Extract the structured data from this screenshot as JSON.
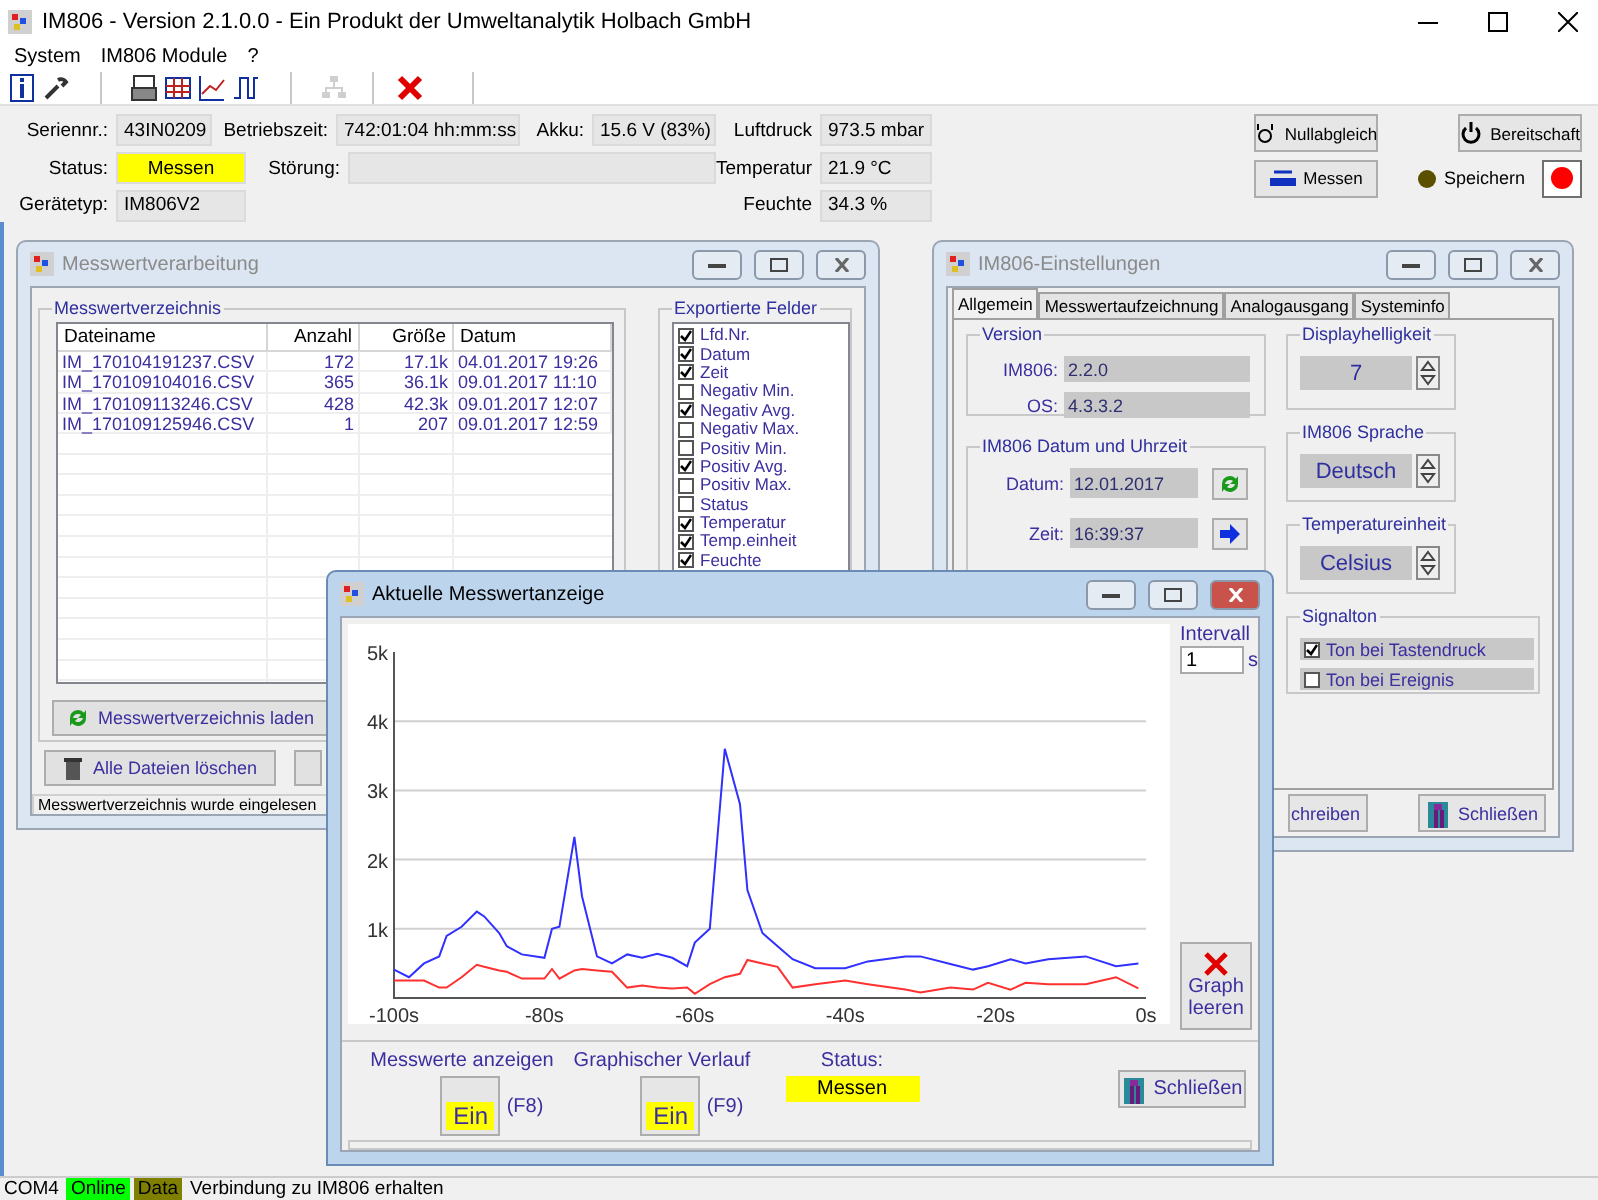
{
  "window": {
    "title": "IM806 - Version 2.1.0.0 - Ein Produkt der Umweltanalytik Holbach GmbH"
  },
  "menu": [
    "System",
    "IM806 Module",
    "?"
  ],
  "toolbar": [
    {
      "disabled": false
    },
    {
      "disabled": false
    },
    {
      "disabled": false
    },
    {
      "disabled": false
    },
    {
      "disabled": false
    },
    {
      "disabled": false
    },
    {
      "disabled": true
    },
    {
      "disabled": false
    }
  ],
  "info_rows": [
    [
      {
        "label": "Seriennr.:",
        "value": "43IN0209",
        "highlighted": false
      },
      {
        "label": "Betriebszeit:",
        "value": "742:01:04 hh:mm:ss",
        "highlighted": false
      },
      {
        "label": "Akku:",
        "value": "15.6 V (83%)",
        "highlighted": false
      },
      {
        "label": "Luftdruck",
        "value": "973.5 mbar",
        "highlighted": false
      }
    ],
    [
      {
        "label": "Status:",
        "value": "Messen",
        "highlighted": true
      },
      {
        "label": "Störung:",
        "highlighted": false
      },
      {
        "label": "Temperatur",
        "value": "21.9 °C",
        "highlighted": false
      }
    ],
    [
      {
        "label": "Gerätetyp:",
        "value": "IM806V2",
        "highlighted": false
      },
      {
        "label": "Feuchte",
        "value": "34.3 %",
        "highlighted": false
      }
    ]
  ],
  "actions": {
    "zero": "Nullabgleich",
    "standby": "Bereitschaft",
    "measure": "Messen",
    "save": {
      "label": "Speichern",
      "on": false
    }
  },
  "processing_window": {
    "title": "Messwertverarbeitung",
    "active": false,
    "directory": {
      "title": "Messwertverzeichnis",
      "columns": [
        "Dateiname",
        "Anzahl",
        "Größe",
        "Datum"
      ],
      "rows": [
        [
          "IM_170104191237.CSV",
          "172",
          "17.1k",
          "04.01.2017 19:26"
        ],
        [
          "IM_170109104016.CSV",
          "365",
          "36.1k",
          "09.01.2017 11:10"
        ],
        [
          "IM_170109113246.CSV",
          "428",
          "42.3k",
          "09.01.2017 12:07"
        ],
        [
          "IM_170109125946.CSV",
          "1",
          "207",
          "09.01.2017 12:59"
        ]
      ],
      "load_button": "Messwertverzeichnis laden"
    },
    "export": {
      "title": "Exportierte Felder",
      "fields": [
        {
          "label": "Lfd.Nr.",
          "checked": true
        },
        {
          "label": "Datum",
          "checked": true
        },
        {
          "label": "Zeit",
          "checked": true
        },
        {
          "label": "Negativ Min.",
          "checked": false
        },
        {
          "label": "Negativ Avg.",
          "checked": true
        },
        {
          "label": "Negativ Max.",
          "checked": false
        },
        {
          "label": "Positiv Min.",
          "checked": false
        },
        {
          "label": "Positiv Avg.",
          "checked": true
        },
        {
          "label": "Positiv Max.",
          "checked": false
        },
        {
          "label": "Status",
          "checked": false
        },
        {
          "label": "Temperatur",
          "checked": true
        },
        {
          "label": "Temp.einheit",
          "checked": true
        },
        {
          "label": "Feuchte",
          "checked": true
        }
      ]
    },
    "delete_button": "Alle Dateien löschen",
    "status": "Messwertverzeichnis wurde eingelesen"
  },
  "settings_window": {
    "title": "IM806-Einstellungen",
    "active": false,
    "tabs": [
      {
        "label": "Allgemein",
        "selected": true
      },
      {
        "label": "Messwertaufzeichnung",
        "selected": false
      },
      {
        "label": "Analogausgang",
        "selected": false
      },
      {
        "label": "Systeminfo",
        "selected": false
      }
    ],
    "version": {
      "title": "Version",
      "fields": [
        {
          "label": "IM806:",
          "value": "2.2.0"
        },
        {
          "label": "OS:",
          "value": "4.3.3.2"
        }
      ]
    },
    "datetime": {
      "title": "IM806 Datum und Uhrzeit",
      "date_label": "Datum:",
      "date": "12.01.2017",
      "time_label": "Zeit:",
      "time": "16:39:37"
    },
    "brightness": {
      "title": "Displayhelligkeit",
      "value": "7"
    },
    "language": {
      "title": "IM806 Sprache",
      "value": "Deutsch"
    },
    "temp_unit": {
      "title": "Temperatureinheit",
      "value": "Celsius"
    },
    "signal": {
      "title": "Signalton",
      "options": [
        {
          "label": "Ton bei Tastendruck",
          "checked": true
        },
        {
          "label": "Ton bei Ereignis",
          "checked": false
        }
      ]
    },
    "buttons": [
      "chreiben",
      "Schließen"
    ]
  },
  "graph_window": {
    "title": "Aktuelle Messwertanzeige",
    "active": true,
    "chart_data": {
      "type": "line",
      "x": [
        -100,
        -98,
        -96,
        -94,
        -93,
        -91,
        -89,
        -88,
        -86,
        -85,
        -83,
        -80,
        -79,
        -78,
        -76,
        -75,
        -73,
        -71,
        -69,
        -67,
        -65,
        -63,
        -61,
        -60,
        -58,
        -56,
        -54,
        -53,
        -51,
        -49,
        -47,
        -44,
        -40,
        -37,
        -32,
        -30,
        -26,
        -23,
        -21,
        -18,
        -16,
        -13,
        -8,
        -4,
        -1
      ],
      "series": [
        {
          "color": "#3030ff",
          "values": [
            410,
            300,
            500,
            600,
            900,
            1030,
            1250,
            1180,
            940,
            750,
            630,
            580,
            1000,
            1030,
            2330,
            1470,
            600,
            500,
            630,
            580,
            640,
            580,
            460,
            800,
            1000,
            3600,
            2800,
            1560,
            940,
            750,
            560,
            430,
            430,
            530,
            600,
            600,
            490,
            410,
            460,
            560,
            500,
            560,
            600,
            460,
            500
          ]
        },
        {
          "color": "#ff3030",
          "values": [
            250,
            250,
            250,
            150,
            150,
            300,
            480,
            450,
            400,
            380,
            280,
            280,
            420,
            280,
            400,
            420,
            400,
            380,
            150,
            180,
            150,
            140,
            150,
            60,
            200,
            300,
            350,
            550,
            500,
            450,
            150,
            200,
            250,
            200,
            120,
            80,
            150,
            120,
            220,
            120,
            220,
            200,
            200,
            300,
            140
          ]
        }
      ],
      "xlim": [
        -100,
        0
      ],
      "ylim": [
        0,
        5000
      ],
      "grid": true,
      "xticks": [
        {
          "value": -100,
          "label": "-100s"
        },
        {
          "value": -80,
          "label": "-80s"
        },
        {
          "value": -60,
          "label": "-60s"
        },
        {
          "value": -40,
          "label": "-40s"
        },
        {
          "value": -20,
          "label": "-20s"
        },
        {
          "value": 0,
          "label": "0s"
        }
      ],
      "yticks": [
        {
          "value": 1000,
          "label": "1k"
        },
        {
          "value": 2000,
          "label": "2k"
        },
        {
          "value": 3000,
          "label": "3k"
        },
        {
          "value": 4000,
          "label": "4k"
        },
        {
          "value": 5000,
          "label": "5k"
        }
      ]
    },
    "interval": {
      "label": "Intervall",
      "value": "1",
      "unit": "s"
    },
    "clear_button": "Graph leeren",
    "toggles": [
      {
        "label": "Messwerte anzeigen",
        "text": "Ein",
        "on": true,
        "key": "(F8)"
      },
      {
        "label": "Graphischer Verlauf",
        "text": "Ein",
        "on": true,
        "key": "(F9)"
      }
    ],
    "status": {
      "label": "Status:",
      "value": "Messen"
    },
    "close_button": "Schließen"
  },
  "status_bar": [
    {
      "text": "COM4"
    },
    {
      "text": "Online",
      "color": "#00ff00"
    },
    {
      "text": "Data",
      "color": "#808000"
    },
    {
      "text": "Verbindung zu IM806 erhalten"
    }
  ]
}
